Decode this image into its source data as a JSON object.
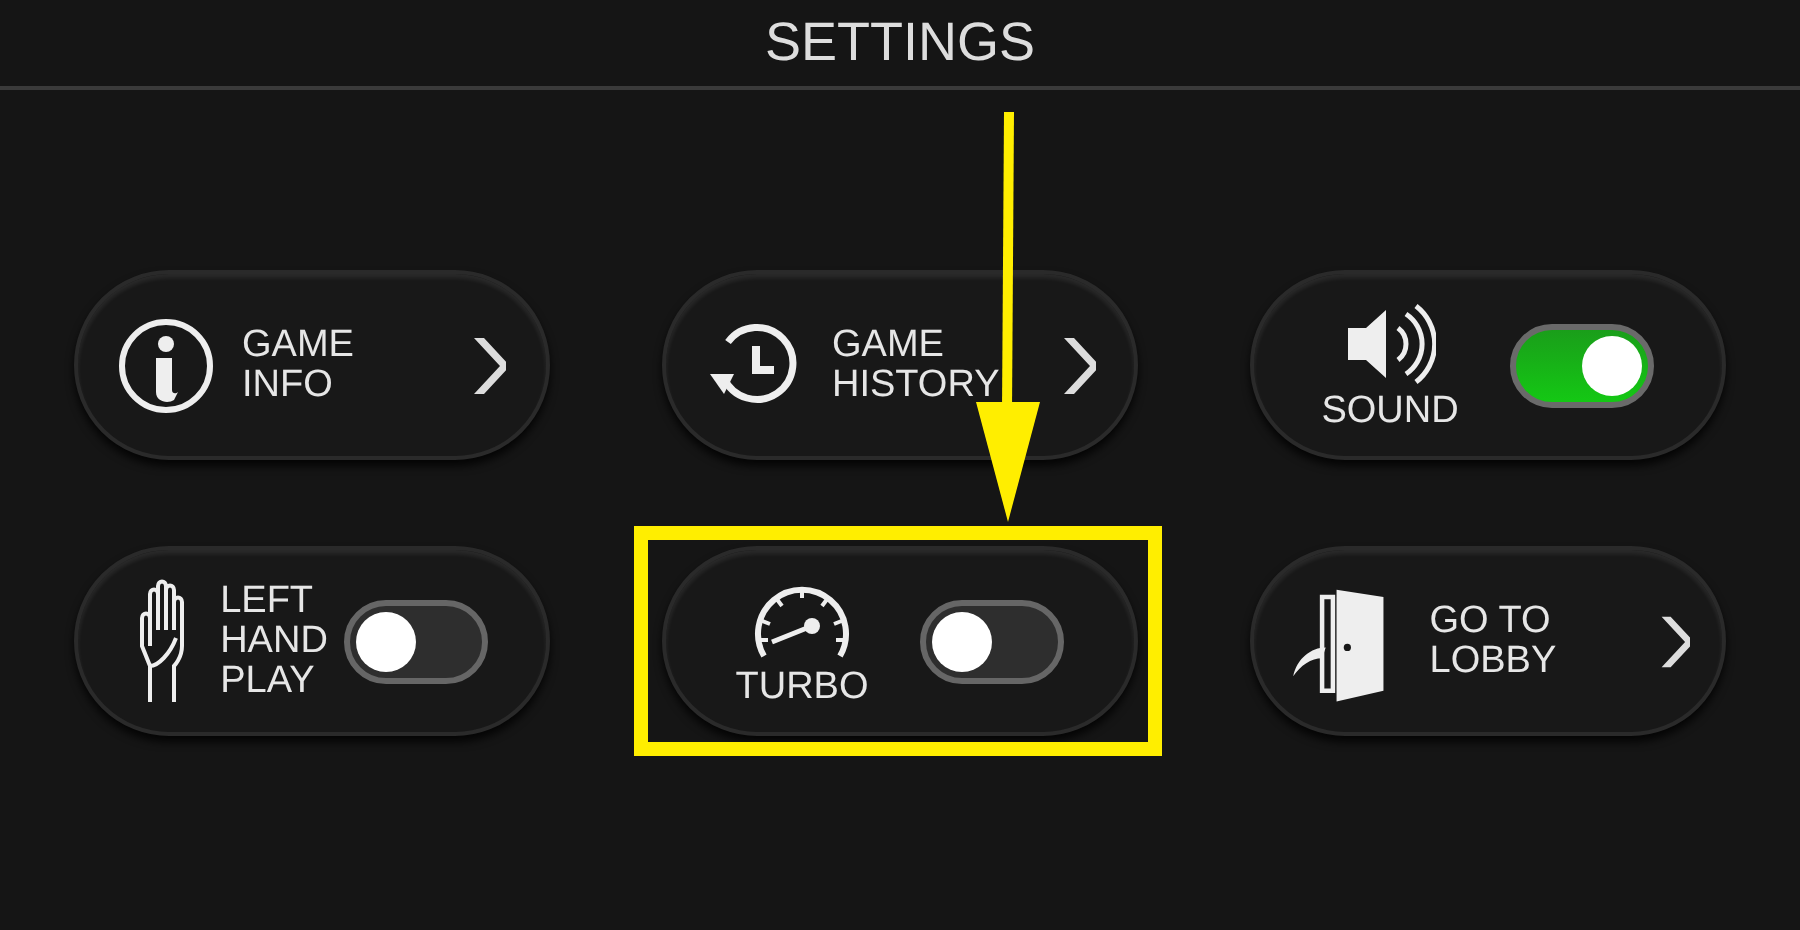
{
  "header": {
    "title": "SETTINGS"
  },
  "items": [
    {
      "kind": "link",
      "label": "GAME\nINFO",
      "highlighted": false
    },
    {
      "kind": "link",
      "label": "GAME\nHISTORY",
      "highlighted": false
    },
    {
      "kind": "toggle-stacked",
      "label": "SOUND",
      "on": true,
      "highlighted": false
    },
    {
      "kind": "toggle",
      "label": "LEFT\nHAND\nPLAY",
      "on": false,
      "highlighted": false
    },
    {
      "kind": "toggle-stacked",
      "label": "TURBO",
      "on": false,
      "highlighted": true
    },
    {
      "kind": "link",
      "label": "GO TO\nLOBBY",
      "highlighted": false
    }
  ]
}
